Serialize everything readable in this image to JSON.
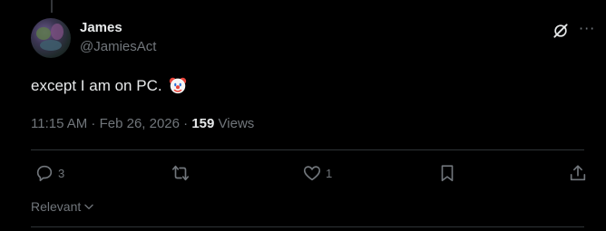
{
  "post": {
    "author_name": "James",
    "author_handle": "@JamiesAct",
    "text": "except I am on PC.",
    "emoji": "clown-face-emoji",
    "time": "11:15 AM · Feb 26, 2026 ·",
    "views_count": "159",
    "views_label": "Views"
  },
  "actions": {
    "replies": "3",
    "reposts": "",
    "likes": "1"
  },
  "sort": {
    "label": "Relevant"
  },
  "icons": {
    "grok": "grok-icon",
    "more": "more-icon",
    "reply": "reply-icon",
    "repost": "repost-icon",
    "like": "heart-icon",
    "bookmark": "bookmark-icon",
    "share": "share-icon",
    "chevron": "chevron-down-icon"
  },
  "colors": {
    "background": "#000000",
    "text_primary": "#e7e9ea",
    "text_secondary": "#71767b",
    "divider": "#2f3336"
  }
}
